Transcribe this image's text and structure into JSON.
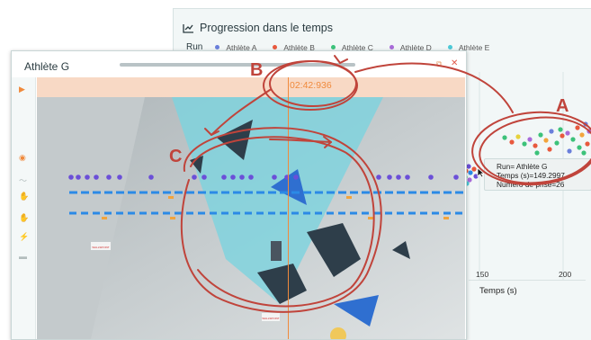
{
  "back_window": {
    "title": "Progression dans le temps",
    "run_label": "Run",
    "legend": [
      {
        "label": "Athlète A",
        "color": "#6a7fdb"
      },
      {
        "label": "Athlète B",
        "color": "#e8593e"
      },
      {
        "label": "Athlète C",
        "color": "#3cc27a"
      },
      {
        "label": "Athlète D",
        "color": "#a86bd9"
      },
      {
        "label": "Athlète E",
        "color": "#4cc9d6"
      }
    ],
    "x_ticks": [
      "150",
      "200"
    ],
    "x_label": "Temps (s)",
    "tooltip": {
      "line1": "Run= Athlète G",
      "line2": "Temps (s)=149.2997",
      "line3": "Numéro de prise=26"
    }
  },
  "front_window": {
    "title": "Athlète G",
    "time": "02:42:936",
    "sign_text": "WALLSPOINT"
  },
  "annotations": {
    "a": "A",
    "b": "B",
    "c": "C",
    "color": "#c0443b"
  },
  "colors": {
    "accent_orange": "#f08a3c",
    "timeline_bg": "#f8d9c5",
    "blue": "#2b8ae6",
    "purple": "#6b4fd8"
  }
}
